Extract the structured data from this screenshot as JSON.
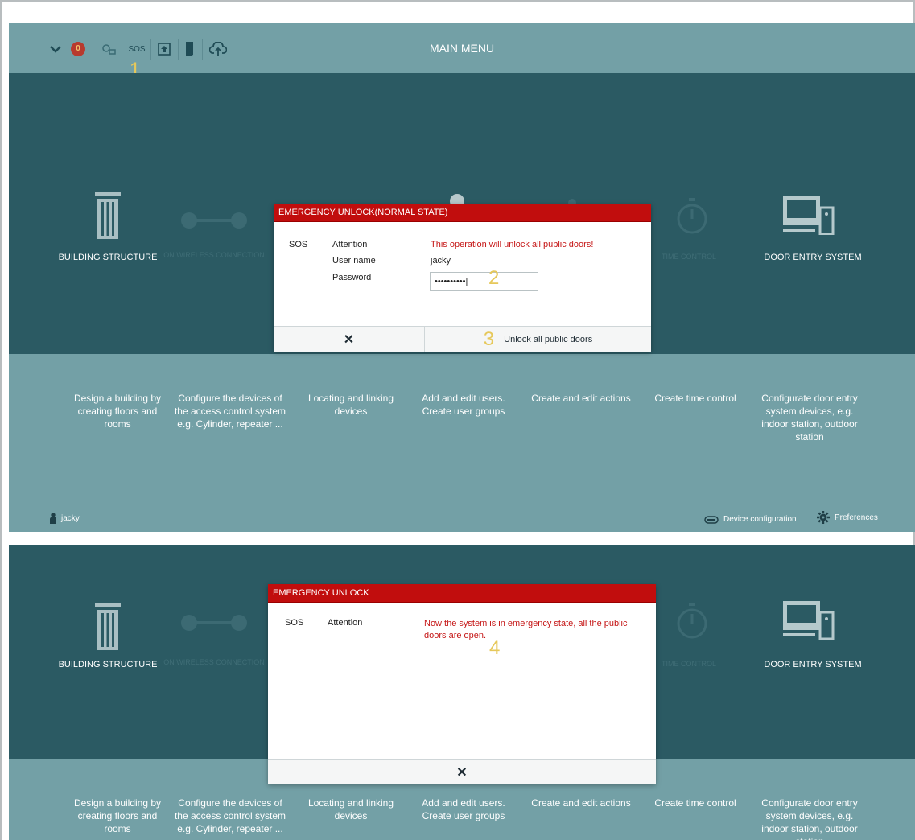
{
  "topbar": {
    "notification_count": "0",
    "sos_label": "SOS",
    "title": "MAIN MENU",
    "icons": [
      "chevron-down-icon",
      "notification-badge",
      "network-icon",
      "sos-button",
      "house-exit-icon",
      "door-icon",
      "cloud-upload-icon"
    ]
  },
  "annotations": {
    "a1": "1",
    "a2": "2",
    "a3": "3",
    "a4": "4"
  },
  "tiles": [
    {
      "label": "BUILDING STRUCTURE",
      "icon": "building-icon"
    },
    {
      "label": "ON WIRELESS CONNECTION",
      "icon": "link-icon"
    },
    {
      "label": "TIME CONTROL",
      "icon": "timer-icon"
    },
    {
      "label": "DOOR ENTRY SYSTEM",
      "icon": "monitor-icon"
    }
  ],
  "descriptions": [
    "Design a building by creating floors and rooms",
    "Configure the devices of the access control system e.g. Cylinder, repeater ...",
    "Locating and linking devices",
    "Add and edit users. Create user groups",
    "Create and edit actions",
    "Create time control",
    "Configurate door entry system devices, e.g. indoor station, outdoor station"
  ],
  "footer": {
    "user": "jacky",
    "device_config": "Device configuration",
    "preferences": "Preferences"
  },
  "dialog1": {
    "title": "EMERGENCY UNLOCK(NORMAL STATE)",
    "sos": "SOS",
    "attention_label": "Attention",
    "attention_text": "This operation will unlock all public doors!",
    "username_label": "User name",
    "username_value": "jacky",
    "password_label": "Password",
    "password_value": "••••••••••",
    "cancel_symbol": "✕",
    "confirm_label": "Unlock all public doors"
  },
  "dialog2": {
    "title": "EMERGENCY UNLOCK",
    "sos": "SOS",
    "attention_label": "Attention",
    "attention_text": "Now the system is in emergency state, all the public doors are open.",
    "close_symbol": "✕"
  },
  "colors": {
    "teal_light": "#73a0a6",
    "teal_dark": "#2b5a63",
    "dialog_header": "#c10d0d",
    "annotation": "#e6c85a"
  }
}
